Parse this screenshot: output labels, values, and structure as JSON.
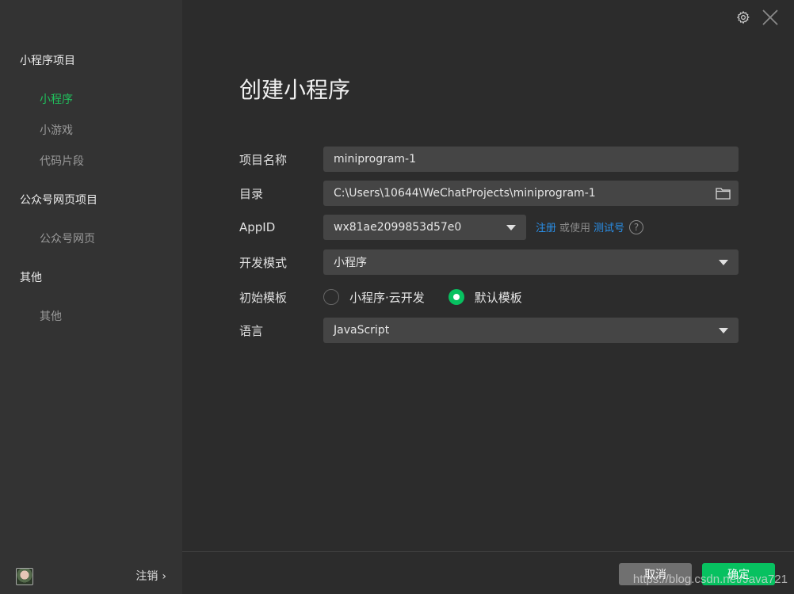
{
  "sidebar": {
    "groups": [
      {
        "title": "小程序项目",
        "items": [
          "小程序",
          "小游戏",
          "代码片段"
        ]
      },
      {
        "title": "公众号网页项目",
        "items": [
          "公众号网页"
        ]
      },
      {
        "title": "其他",
        "items": [
          "其他"
        ]
      }
    ],
    "active_item": "小程序",
    "logout_label": "注销",
    "logout_chevron": "›"
  },
  "header": {
    "settings_icon": "gear-icon",
    "close_icon": "close-icon"
  },
  "main": {
    "title": "创建小程序",
    "form": {
      "project_name": {
        "label": "项目名称",
        "value": "miniprogram-1"
      },
      "directory": {
        "label": "目录",
        "value": "C:\\Users\\10644\\WeChatProjects\\miniprogram-1",
        "icon": "folder-icon"
      },
      "appid": {
        "label": "AppID",
        "value": "wx81ae2099853d57e0",
        "register_link": "注册",
        "or_use_text": "或使用",
        "test_account_link": "测试号",
        "help": "?"
      },
      "dev_mode": {
        "label": "开发模式",
        "value": "小程序"
      },
      "template": {
        "label": "初始模板",
        "options": [
          "小程序·云开发",
          "默认模板"
        ],
        "selected": "默认模板"
      },
      "language": {
        "label": "语言",
        "value": "JavaScript"
      }
    }
  },
  "footer": {
    "cancel_label": "取消",
    "confirm_label": "确定"
  },
  "watermark": "https://blog.csdn.net/Java721",
  "colors": {
    "accent_green": "#07c160",
    "link_blue": "#2a8fe8",
    "sidebar_bg": "#333333",
    "main_bg": "#2c2c2c",
    "field_bg": "#454545"
  }
}
